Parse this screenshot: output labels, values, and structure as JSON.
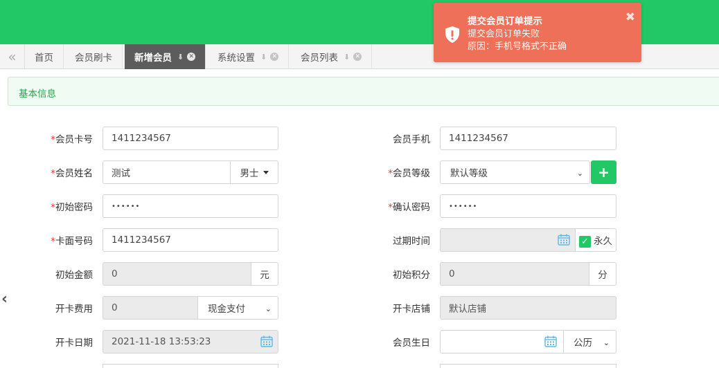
{
  "tabs": {
    "back_icon": "double-chevron-left-icon",
    "items": [
      {
        "label": "首页"
      },
      {
        "label": "会员刷卡"
      },
      {
        "label": "新增会员"
      },
      {
        "label": "系统设置"
      },
      {
        "label": "会员列表"
      }
    ]
  },
  "section": {
    "title": "基本信息"
  },
  "form": {
    "card_no": {
      "label": "会员卡号",
      "value": "1411234567"
    },
    "phone": {
      "label": "会员手机",
      "value": "1411234567"
    },
    "name": {
      "label": "会员姓名",
      "value": "测试",
      "gender": "男士"
    },
    "level": {
      "label": "会员等级",
      "value": "默认等级"
    },
    "init_pwd": {
      "label": "初始密码",
      "value": "••••••"
    },
    "confirm_pwd": {
      "label": "确认密码",
      "value": "••••••"
    },
    "face_no": {
      "label": "卡面号码",
      "value": "1411234567"
    },
    "expire": {
      "label": "过期时间",
      "value": "",
      "forever_label": "永久",
      "forever_checked": true
    },
    "init_amount": {
      "label": "初始金额",
      "value": "0",
      "unit": "元"
    },
    "init_points": {
      "label": "初始积分",
      "value": "0",
      "unit": "分"
    },
    "card_fee": {
      "label": "开卡费用",
      "value": "0",
      "payment": "现金支付"
    },
    "store": {
      "label": "开卡店铺",
      "value": "默认店铺"
    },
    "open_date": {
      "label": "开卡日期",
      "value": "2021-11-18 13:53:23"
    },
    "birthday": {
      "label": "会员生日",
      "value": "",
      "calendar": "公历"
    }
  },
  "toast": {
    "title": "提交会员订单提示",
    "line1": "提交会员订单失败",
    "line2": "原因：手机号格式不正确",
    "close_glyph": "✖",
    "bg": "#ee7059"
  },
  "colors": {
    "brand": "#22c865",
    "header": "#22c865"
  }
}
